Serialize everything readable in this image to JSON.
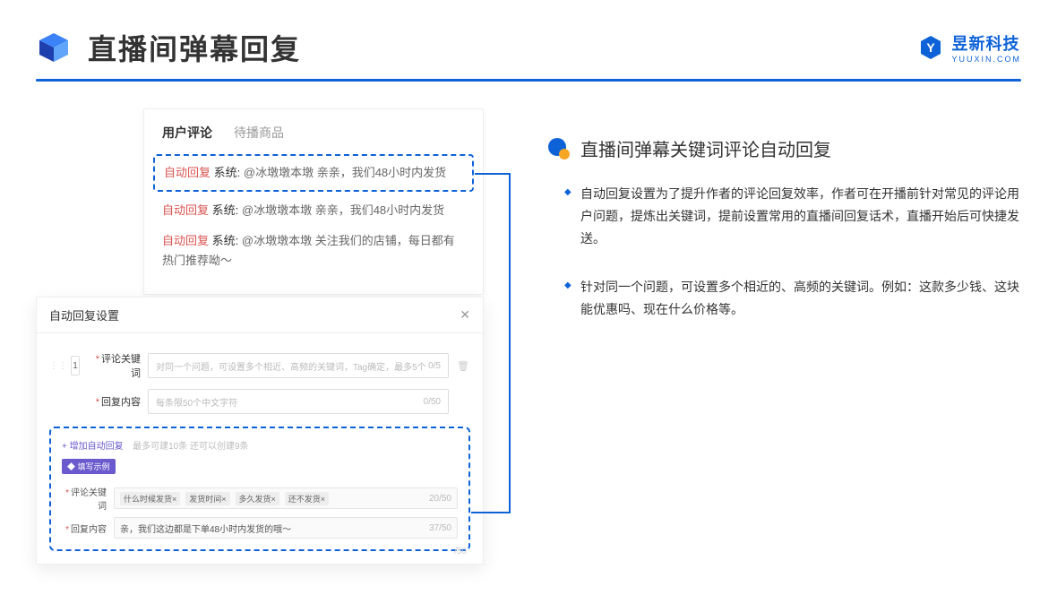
{
  "header": {
    "title": "直播间弹幕回复",
    "brand_name": "昱新科技",
    "brand_sub": "YUUXIN.COM"
  },
  "comments": {
    "tabs": {
      "active": "用户评论",
      "inactive": "待播商品"
    },
    "items": [
      {
        "tag": "自动回复",
        "sys": "系统:",
        "text": "@冰墩墩本墩 亲亲，我们48小时内发货"
      },
      {
        "tag": "自动回复",
        "sys": "系统:",
        "text": "@冰墩墩本墩 亲亲，我们48小时内发货"
      },
      {
        "tag": "自动回复",
        "sys": "系统:",
        "text": "@冰墩墩本墩 关注我们的店铺，每日都有热门推荐呦～"
      }
    ]
  },
  "settings": {
    "title": "自动回复设置",
    "idx": "1",
    "keyword_label": "评论关键词",
    "keyword_placeholder": "对同一个问题，可设置多个相近、高频的关键词，Tag确定，最多5个",
    "keyword_counter": "0/5",
    "content_label": "回复内容",
    "content_placeholder": "每条限50个中文字符",
    "content_counter": "0/50",
    "add_link": "+ 增加自动回复",
    "add_hint": "最多可建10条 还可以创建9条",
    "example_badge": "◆ 填写示例",
    "ex_keyword_label": "评论关键词",
    "ex_tags": [
      "什么时候发货×",
      "发货时间×",
      "多久发货×",
      "还不发货×"
    ],
    "ex_keyword_counter": "20/50",
    "ex_content_label": "回复内容",
    "ex_content_text": "亲，我们这边都是下单48小时内发货的哦～",
    "ex_content_counter": "37/50",
    "outer_counter": "/50"
  },
  "right": {
    "section_title": "直播间弹幕关键词评论自动回复",
    "bullets": [
      "自动回复设置为了提升作者的评论回复效率，作者可在开播前针对常见的评论用户问题，提炼出关键词，提前设置常用的直播间回复话术，直播开始后可快捷发送。",
      "针对同一个问题，可设置多个相近的、高频的关键词。例如：这款多少钱、这块能优惠吗、现在什么价格等。"
    ]
  }
}
